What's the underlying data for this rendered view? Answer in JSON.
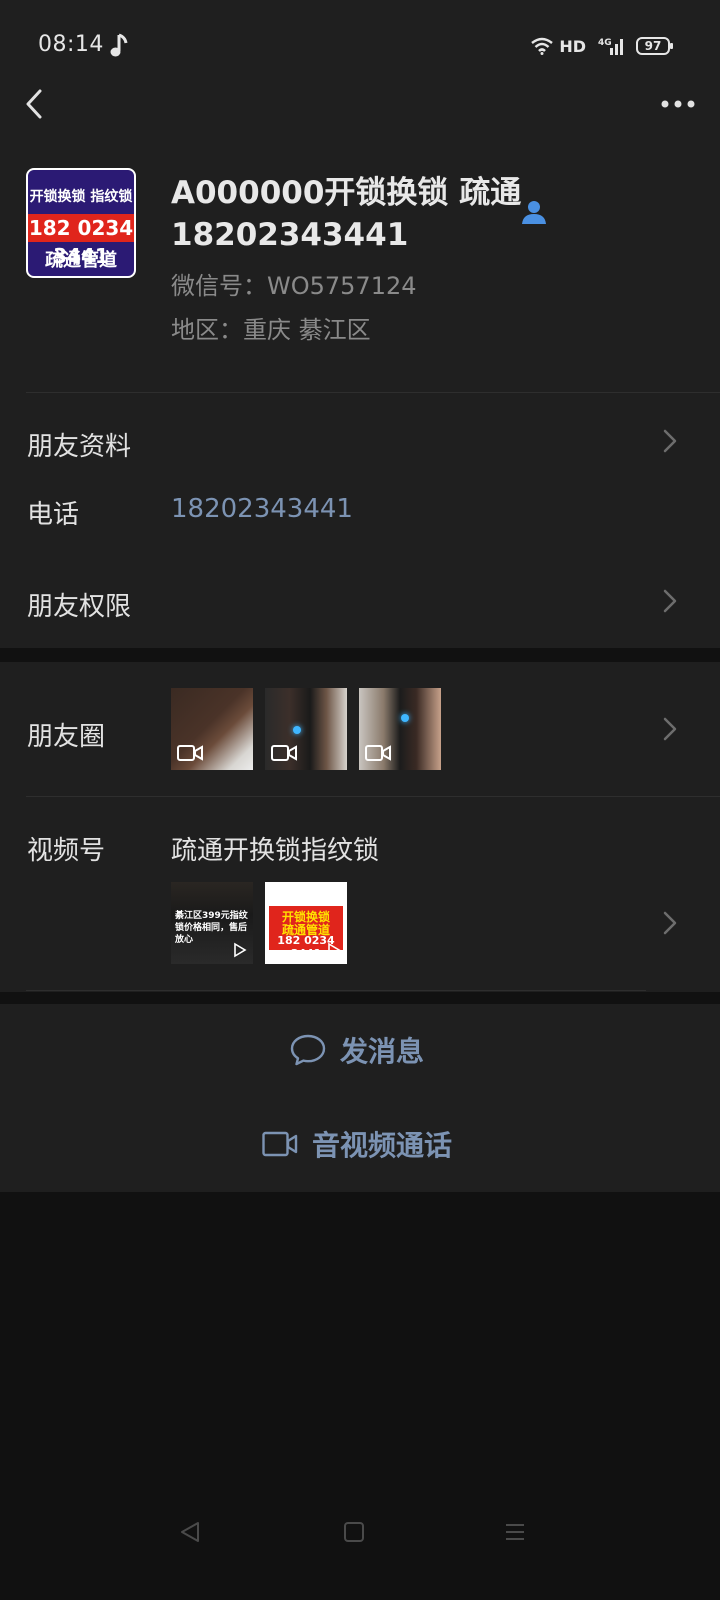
{
  "status_bar": {
    "time": "08:14",
    "network": "HD",
    "signal_label": "4G",
    "battery": "97",
    "music_icon": "music-note-icon"
  },
  "header": {
    "back_icon": "chevron-left-icon",
    "more_icon": "more-dots-icon"
  },
  "profile": {
    "avatar_text": {
      "line1": "开锁换锁 指纹锁",
      "line2": "182 0234 3441",
      "line3": "疏通管道"
    },
    "name": "A000000开锁换锁 疏通18202343441",
    "contact_icon": "contact-person-icon",
    "wechat_id": "微信号：WO5757124",
    "region": "地区：重庆  綦江区"
  },
  "info": {
    "friend_info_label": "朋友资料",
    "phone_label": "电话",
    "phone_value": "18202343441",
    "permissions_label": "朋友权限"
  },
  "moments": {
    "label": "朋友圈",
    "thumbnail_count": 3
  },
  "channels": {
    "label": "视频号",
    "title": "疏通开换锁指纹锁",
    "video1_caption": "綦江区399元指纹锁价格相同，售后放心",
    "video2_line1": "开锁换锁",
    "video2_line2": "疏通管道",
    "video2_line3": "182 0234 3441"
  },
  "actions": {
    "send_message": "发消息",
    "video_call": "音视频通话"
  },
  "colors": {
    "background": "#111111",
    "card": "#1f1f1f",
    "link": "#7c93b3",
    "secondary_text": "#8a8a8a",
    "contact_icon": "#4a90e2"
  }
}
